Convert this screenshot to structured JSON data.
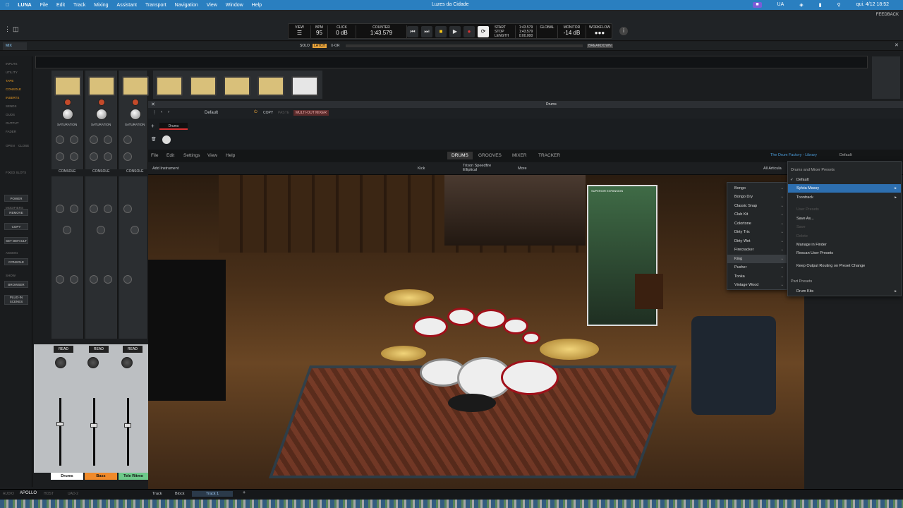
{
  "menubar": {
    "app": "LUNA",
    "items": [
      "File",
      "Edit",
      "Track",
      "Mixing",
      "Assistant",
      "Transport",
      "Navigation",
      "View",
      "Window",
      "Help"
    ],
    "window_title": "Luzes da Cidade",
    "ua_label": "UA",
    "datetime": "qui. 4/12  18:52"
  },
  "topstrip": {
    "feedback": "FEEDBACK",
    "transport": {
      "view_label": "VIEW",
      "bpm_label": "BPM",
      "bpm_value": "95",
      "click_label": "CLICK",
      "click_value": "0 dB",
      "counter_label": "COUNTER",
      "counter_value": "1:43.579",
      "start_label": "START",
      "stop_label": "STOP",
      "length_label": "LENGTH",
      "start_value": "1:43.579",
      "stop_value": "1:43.579",
      "length_value": "0:00.000",
      "global_label": "GLOBAL",
      "monitor_label": "MONITOR",
      "monitor_value": "-14 dB",
      "workflow_label": "WORKFLOW"
    }
  },
  "solostrip": {
    "solo": "SOLO",
    "latch": "LATCH",
    "xor": "X-OR",
    "breakdown": "BREAKDOWN"
  },
  "mixtab": "MIX",
  "sidebar": {
    "labels": [
      "INPUTS",
      "UTILITY",
      "TAPE",
      "CONSOLE",
      "INSERTS",
      "SENDS",
      "OUDS",
      "OUTPUT",
      "FADER"
    ],
    "active": [
      "TAPE",
      "CONSOLE",
      "INSERTS"
    ],
    "open": "OPEN",
    "close": "CLOSE",
    "fixed_slots": "FIXED SLOTS",
    "modifiers": "MODIFIERS",
    "power": "POWER",
    "remove": "REMOVE",
    "copy": "COPY",
    "set_default": "SET DEFAULT",
    "assign": "ASSIGN",
    "console": "CONSOLE",
    "show": "SHOW",
    "browser": "BROWSER",
    "plugin_scenes": "PLUG-IN SCENES"
  },
  "strips": [
    {
      "name": "Drums",
      "color": "#ffffff",
      "console": "CONSOLE",
      "saturation": "SATURATION",
      "read": "READ"
    },
    {
      "name": "Bass",
      "color": "#f08a2a",
      "console": "CONSOLE",
      "saturation": "SATURATION",
      "read": "READ"
    },
    {
      "name": "Tele Ritmo",
      "color": "#6ec98a",
      "console": "CONSOLE",
      "saturation": "SATURATION",
      "read": "READ"
    }
  ],
  "plugin": {
    "header": "Drums",
    "preset": "Default",
    "copy": "COPY",
    "paste": "PASTE",
    "multiout": "MULTI-OUT MIXER",
    "instrument_chip": "Drums",
    "menu": [
      "File",
      "Edit",
      "Settings",
      "View",
      "Help"
    ],
    "tabs": [
      "DRUMS",
      "GROOVES",
      "MIXER",
      "TRACKER"
    ],
    "active_tab": "DRUMS",
    "library": "The Drum Factory - Library",
    "library_preset": "Default",
    "add_instrument": "Add Instrument",
    "kick": "Kick",
    "speedfire": "Trixon Speedfire Elliptical",
    "more": "More",
    "all_artic": "All Articula",
    "banner_text": "SUPERIOR EXPANSION"
  },
  "kit_menu": {
    "items": [
      "Bongo",
      "Bongo Dry",
      "Classic Snap",
      "Club Kit",
      "Colortone",
      "Dirty Trix",
      "Dirty Wet",
      "Firecracker",
      "King",
      "Pusher",
      "Tonka",
      "Vintage Wood"
    ],
    "hovered": "King"
  },
  "preset_menu": {
    "header": "Drums and Mixer Presets",
    "default": "Default",
    "sylvia": "Sylvia Massy",
    "toontrack": "Toontrack",
    "user_presets": "User Presets",
    "save": "Save",
    "delete": "Delete",
    "save_as": "Save As...",
    "manage": "Manage in Finder",
    "rescan": "Rescan User Presets",
    "keep_routing": "Keep Output Routing on Preset Change",
    "part_presets": "Part Presets",
    "drum_kits": "Drum Kits"
  },
  "bottom": {
    "audio": "AUDIO",
    "apollo": "APOLLO",
    "host": "HOST",
    "ua_d": "UAD-2",
    "track": "Track",
    "block": "Block",
    "track1": "Track 1"
  }
}
